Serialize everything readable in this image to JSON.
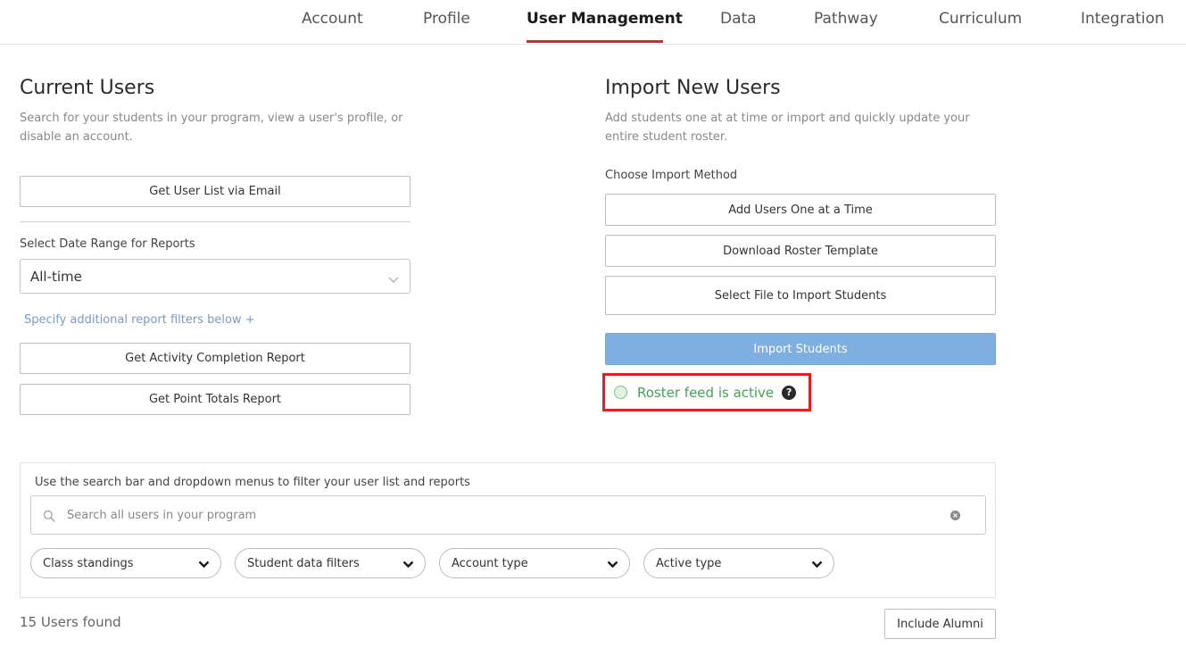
{
  "nav": {
    "tabs": [
      {
        "label": "Account"
      },
      {
        "label": "Profile"
      },
      {
        "label": "User Management"
      },
      {
        "label": "Data"
      },
      {
        "label": "Pathway"
      },
      {
        "label": "Curriculum"
      },
      {
        "label": "Integration"
      }
    ],
    "active_index": 2,
    "accent_color": "#d9262d"
  },
  "current_users": {
    "title": "Current Users",
    "description": "Search for your students in your program, view a user's profile, or disable an account.",
    "get_user_list_label": "Get User List via Email",
    "date_range_label": "Select Date Range for Reports",
    "date_range_value": "All-time",
    "additional_filters_link": "Specify additional report filters below +",
    "activity_report_label": "Get Activity Completion Report",
    "point_totals_label": "Get Point Totals Report"
  },
  "import_users": {
    "title": "Import New Users",
    "description": "Add students one at at time or import and quickly update your entire student roster.",
    "choose_method_label": "Choose Import Method",
    "add_one_label": "Add Users One at a Time",
    "download_template_label": "Download Roster Template",
    "select_file_label": "Select File to Import Students",
    "import_label": "Import Students",
    "roster_status": "Roster feed is active",
    "help_glyph": "?",
    "status_color": "#47a155"
  },
  "filters": {
    "hint": "Use the search bar and dropdown menus to filter your user list and reports",
    "search_placeholder": "Search all users in your program",
    "dropdowns": [
      {
        "label": "Class standings"
      },
      {
        "label": "Student data filters"
      },
      {
        "label": "Account type"
      },
      {
        "label": "Active type"
      }
    ]
  },
  "results": {
    "count_text": "15 Users found",
    "include_alumni_label": "Include Alumni"
  }
}
